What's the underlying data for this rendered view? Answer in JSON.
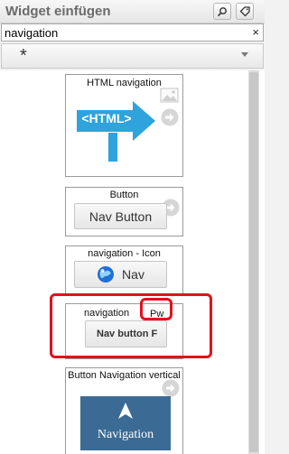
{
  "header": {
    "title": "Widget einfügen",
    "search_button_icon": "magnifier-icon",
    "tag_button_icon": "tag-icon"
  },
  "search": {
    "value": "navigation",
    "clear_label": "×"
  },
  "filter": {
    "selected": "*"
  },
  "widgets": [
    {
      "title": "HTML navigation",
      "preview_label": "<HTML>",
      "icon": "arrow-sign-icon"
    },
    {
      "title": "Button",
      "preview_label": "Nav Button"
    },
    {
      "title": "navigation - Icon",
      "preview_label": "Nav",
      "icon": "globe-icon"
    },
    {
      "title": "navigation",
      "badge": "Pw",
      "preview_label": "Nav button F"
    },
    {
      "title": "Button Navigation vertical",
      "preview_label": "Navigation",
      "icon": "navigation-arrow-icon"
    }
  ],
  "colors": {
    "highlight": "#e0121b",
    "html_sign": "#2ea3dc",
    "nav_tile": "#3b6a94"
  }
}
